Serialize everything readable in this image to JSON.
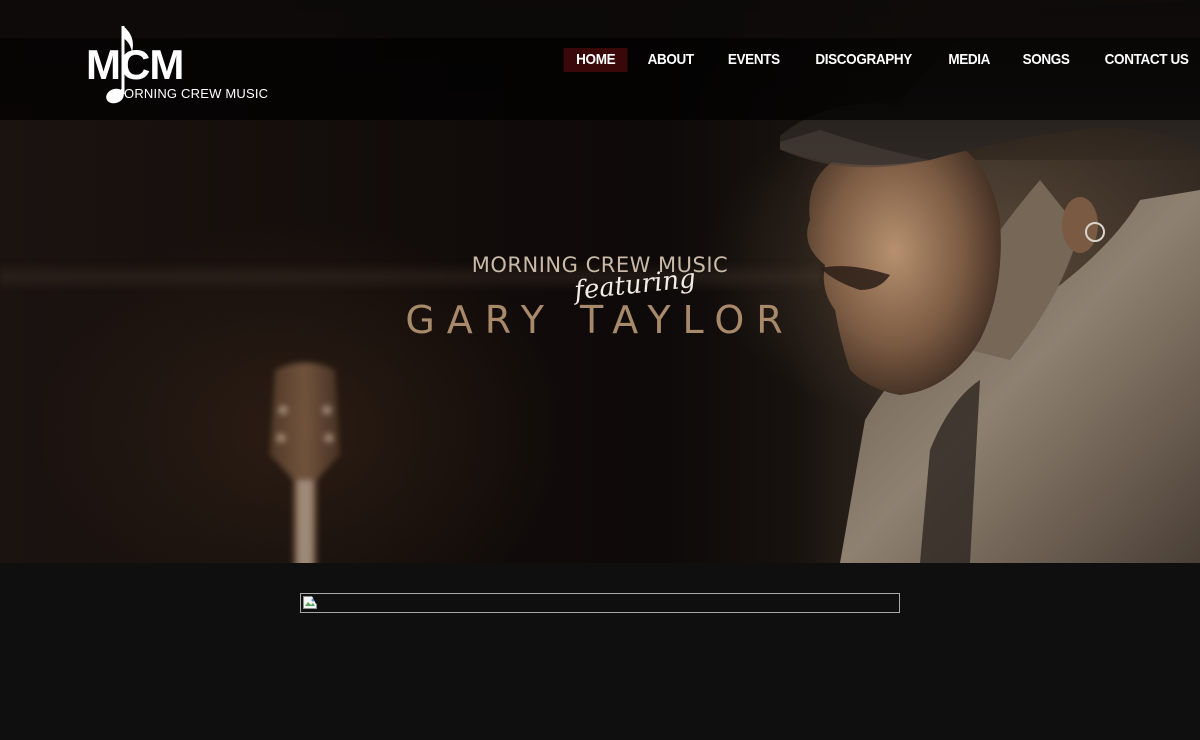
{
  "site": {
    "logo": {
      "letters": "MCM",
      "subtitle": "MORNING CREW MUSIC",
      "icon": "music-note-icon"
    },
    "nav": {
      "items": [
        {
          "label": "HOME",
          "active": true
        },
        {
          "label": "ABOUT",
          "active": false
        },
        {
          "label": "EVENTS",
          "active": false
        },
        {
          "label": "DISCOGRAPHY",
          "active": false
        },
        {
          "label": "MEDIA",
          "active": false
        },
        {
          "label": "SONGS",
          "active": false
        },
        {
          "label": "CONTACT US",
          "active": false
        }
      ]
    },
    "hero": {
      "line1": "MORNING CREW MUSIC",
      "line2": "featuring",
      "line3": "GARY TAYLOR"
    },
    "content": {
      "image_icon": "broken-image-icon"
    }
  },
  "colors": {
    "nav_active_bg": "#3a0808",
    "hero_accent": "#a8896a",
    "page_bg": "#0f0f0f"
  }
}
